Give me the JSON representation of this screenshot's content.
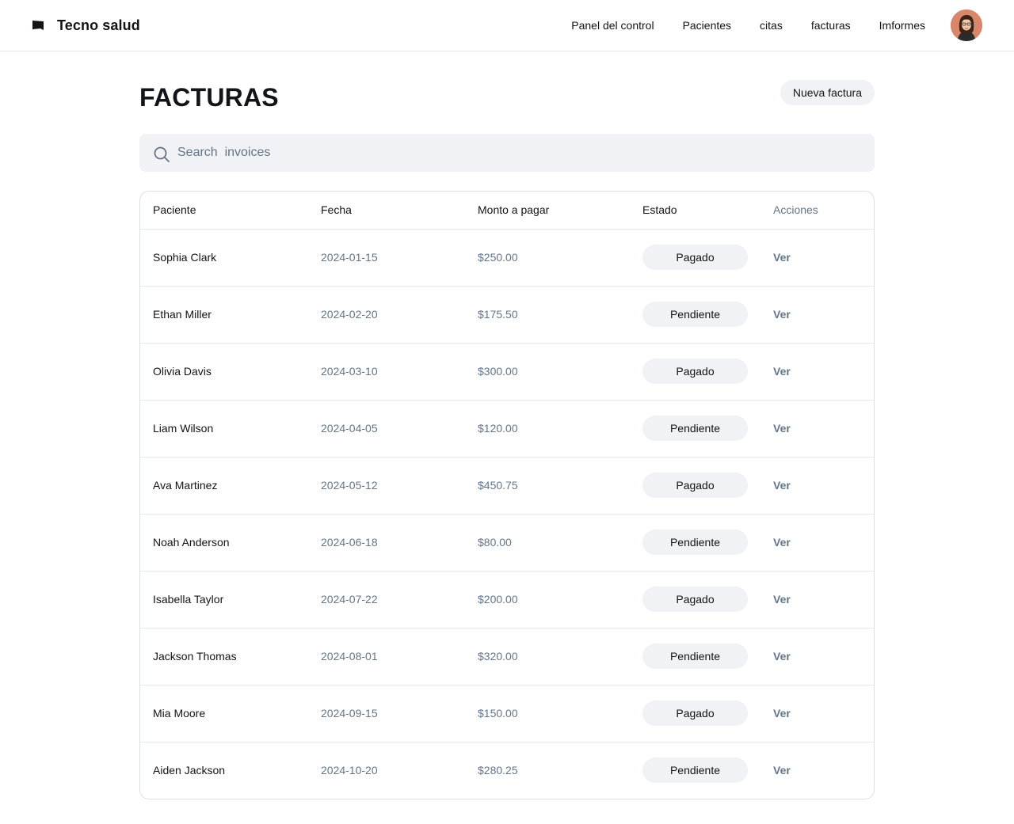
{
  "header": {
    "brand": "Tecno salud",
    "nav": [
      "Panel del control",
      "Pacientes",
      "citas",
      "facturas",
      "Imformes"
    ]
  },
  "page": {
    "title": "FACTURAS",
    "new_button": "Nueva factura"
  },
  "search": {
    "placeholder": "Search  invoices"
  },
  "table": {
    "columns": {
      "patient": "Paciente",
      "date": "Fecha",
      "amount": "Monto a pagar",
      "status": "Estado",
      "actions": "Acciones"
    },
    "rows": [
      {
        "patient": "Sophia Clark",
        "date": "2024-01-15",
        "amount": "$250.00",
        "status": "Pagado",
        "action": "Ver"
      },
      {
        "patient": "Ethan Miller",
        "date": "2024-02-20",
        "amount": "$175.50",
        "status": "Pendiente",
        "action": "Ver"
      },
      {
        "patient": "Olivia Davis",
        "date": "2024-03-10",
        "amount": "$300.00",
        "status": "Pagado",
        "action": "Ver"
      },
      {
        "patient": "Liam Wilson",
        "date": "2024-04-05",
        "amount": "$120.00",
        "status": "Pendiente",
        "action": "Ver"
      },
      {
        "patient": "Ava Martinez",
        "date": "2024-05-12",
        "amount": "$450.75",
        "status": "Pagado",
        "action": "Ver"
      },
      {
        "patient": "Noah Anderson",
        "date": "2024-06-18",
        "amount": "$80.00",
        "status": "Pendiente",
        "action": "Ver"
      },
      {
        "patient": "Isabella Taylor",
        "date": "2024-07-22",
        "amount": "$200.00",
        "status": "Pagado",
        "action": "Ver"
      },
      {
        "patient": "Jackson Thomas",
        "date": "2024-08-01",
        "amount": "$320.00",
        "status": "Pendiente",
        "action": "Ver"
      },
      {
        "patient": "Mia Moore",
        "date": "2024-09-15",
        "amount": "$150.00",
        "status": "Pagado",
        "action": "Ver"
      },
      {
        "patient": "Aiden Jackson",
        "date": "2024-10-20",
        "amount": "$280.25",
        "status": "Pendiente",
        "action": "Ver"
      }
    ]
  },
  "icons": {
    "brand": "brand-flag-icon",
    "search": "search-icon"
  },
  "colors": {
    "text": "#111418",
    "muted": "#637588",
    "pill": "#f0f2f5",
    "border": "#dbe0e5"
  }
}
